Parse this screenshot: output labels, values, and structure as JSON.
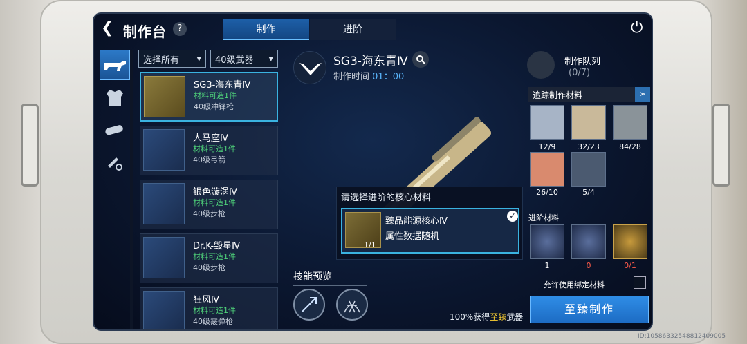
{
  "header": {
    "back_icon": "arrow-left-icon",
    "title": "制作台",
    "help_label": "?",
    "power_icon": "power-icon"
  },
  "tabs": [
    {
      "label": "制作",
      "selected": true
    },
    {
      "label": "进阶",
      "selected": false
    }
  ],
  "filters": {
    "filter1": "选择所有",
    "filter2": "40级武器"
  },
  "categories": [
    {
      "icon": "rifle-icon",
      "selected": true
    },
    {
      "icon": "armor-icon",
      "selected": false
    },
    {
      "icon": "pipe-icon",
      "selected": false
    },
    {
      "icon": "tools-icon",
      "selected": false
    }
  ],
  "weapons": [
    {
      "name": "SG3-海东青Ⅳ",
      "status": "材料可造1件",
      "type": "40级冲锋枪",
      "selected": true
    },
    {
      "name": "人马座Ⅳ",
      "status": "材料可造1件",
      "type": "40级弓箭",
      "selected": false
    },
    {
      "name": "银色漩涡Ⅳ",
      "status": "材料可造1件",
      "type": "40级步枪",
      "selected": false
    },
    {
      "name": "Dr.K-毁星Ⅳ",
      "status": "材料可造1件",
      "type": "40级步枪",
      "selected": false
    },
    {
      "name": "狂风Ⅳ",
      "status": "材料可造1件",
      "type": "40级霰弹枪",
      "selected": false
    }
  ],
  "detail": {
    "name": "SG3-海东青Ⅳ",
    "time_label": "制作时间",
    "time_value": "01：00",
    "search_icon": "search-icon"
  },
  "popup": {
    "title": "请选择进阶的核心材料",
    "core_name": "臻品能源核心Ⅳ",
    "core_desc": "属性数据随机",
    "core_count": "1/1",
    "check_icon": "check-icon"
  },
  "skills": {
    "title": "技能预览",
    "icons": [
      "skill-spear-icon",
      "skill-net-icon"
    ]
  },
  "guarantee": {
    "prefix": "100%获得",
    "highlight": "至臻",
    "suffix": "武器"
  },
  "queue": {
    "title": "制作队列",
    "count": "(0/7)"
  },
  "track": {
    "title": "追踪制作材料",
    "arrow": "»"
  },
  "materials": [
    {
      "count": "12/9",
      "color": "#a7b4c6"
    },
    {
      "count": "32/23",
      "color": "#c9b99a"
    },
    {
      "count": "84/28",
      "color": "#8a9399"
    },
    {
      "count": "26/10",
      "color": "#d98a6e"
    },
    {
      "count": "5/4",
      "color": "#4b5a70"
    }
  ],
  "advanced": {
    "title": "进阶材料",
    "items": [
      {
        "value": "1",
        "color": "#ffffff"
      },
      {
        "value": "0",
        "color": "#ff5a4a"
      },
      {
        "value": "0/1",
        "color": "#ff5a4a"
      }
    ]
  },
  "allow_bound": "允许使用绑定材料",
  "craft_button": "至臻制作",
  "id_text": "ID:10586332548812409005"
}
